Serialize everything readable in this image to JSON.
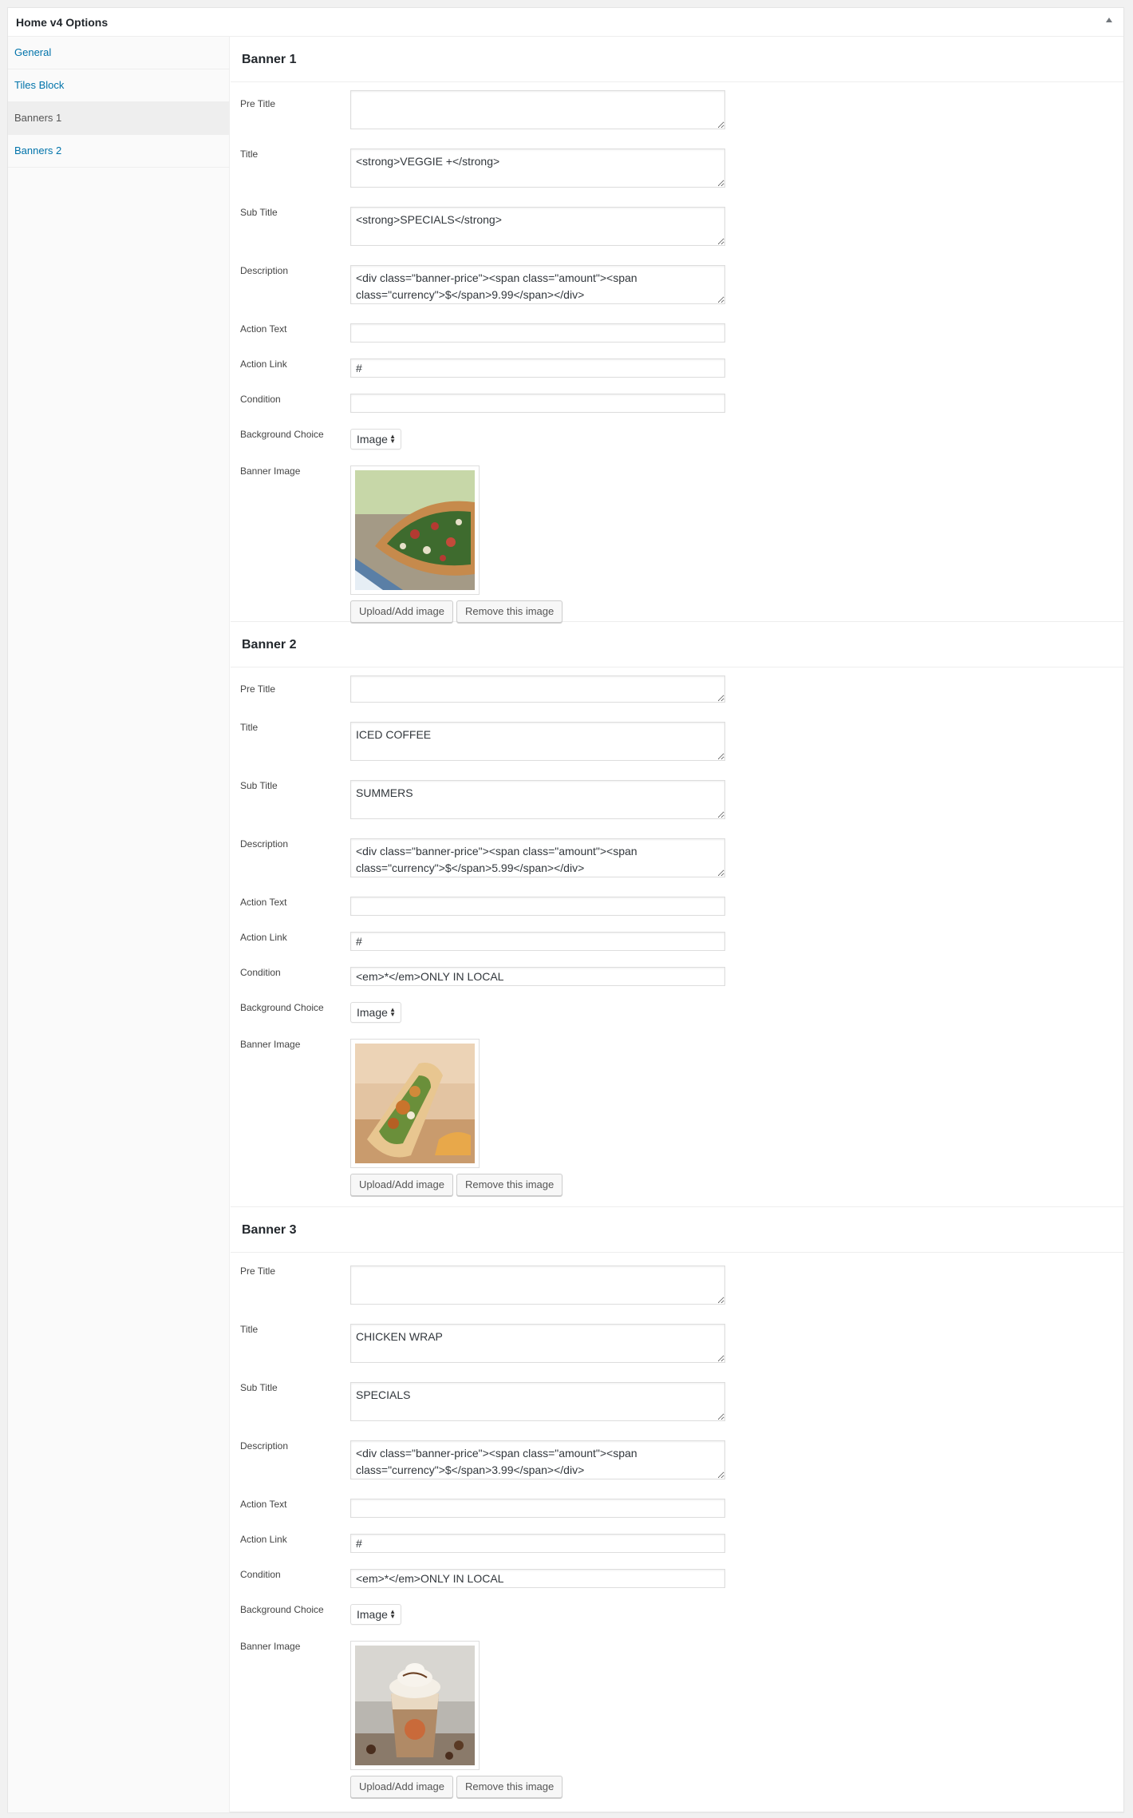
{
  "panel": {
    "title": "Home v4 Options"
  },
  "sidebar": {
    "items": [
      {
        "label": "General"
      },
      {
        "label": "Tiles Block"
      },
      {
        "label": "Banners 1"
      },
      {
        "label": "Banners 2"
      }
    ]
  },
  "labels": {
    "pre_title": "Pre Title",
    "title": "Title",
    "sub_title": "Sub Title",
    "description": "Description",
    "action_text": "Action Text",
    "action_link": "Action Link",
    "condition": "Condition",
    "background_choice": "Background Choice",
    "banner_image": "Banner Image"
  },
  "buttons": {
    "upload": "Upload/Add image",
    "remove": "Remove this image"
  },
  "banners": [
    {
      "heading": "Banner 1",
      "pre_title": "",
      "title": "<strong>VEGGIE +</strong>",
      "sub_title": "<strong>SPECIALS</strong>",
      "description": "<div class=\"banner-price\"><span class=\"amount\"><span class=\"currency\">$</span>9.99</span></div>",
      "action_text": "",
      "action_link": "#",
      "condition": "",
      "background_choice": "Image",
      "image_subject": "veggie pizza"
    },
    {
      "heading": "Banner 2",
      "pre_title": "",
      "title": "ICED COFFEE",
      "sub_title": "SUMMERS",
      "description": "<div class=\"banner-price\"><span class=\"amount\"><span class=\"currency\">$</span>5.99</span></div>",
      "action_text": "",
      "action_link": "#",
      "condition": "<em>*</em>ONLY IN LOCAL",
      "background_choice": "Image",
      "image_subject": "chicken wrap"
    },
    {
      "heading": "Banner 3",
      "pre_title": "",
      "title": "CHICKEN WRAP",
      "sub_title": "SPECIALS",
      "description": "<div class=\"banner-price\"><span class=\"amount\"><span class=\"currency\">$</span>3.99</span></div>",
      "action_text": "",
      "action_link": "#",
      "condition": "<em>*</em>ONLY IN LOCAL",
      "background_choice": "Image",
      "image_subject": "iced coffee"
    }
  ],
  "icons": {
    "collapse": "triangle-up-icon",
    "select": "updown-arrows-icon"
  }
}
